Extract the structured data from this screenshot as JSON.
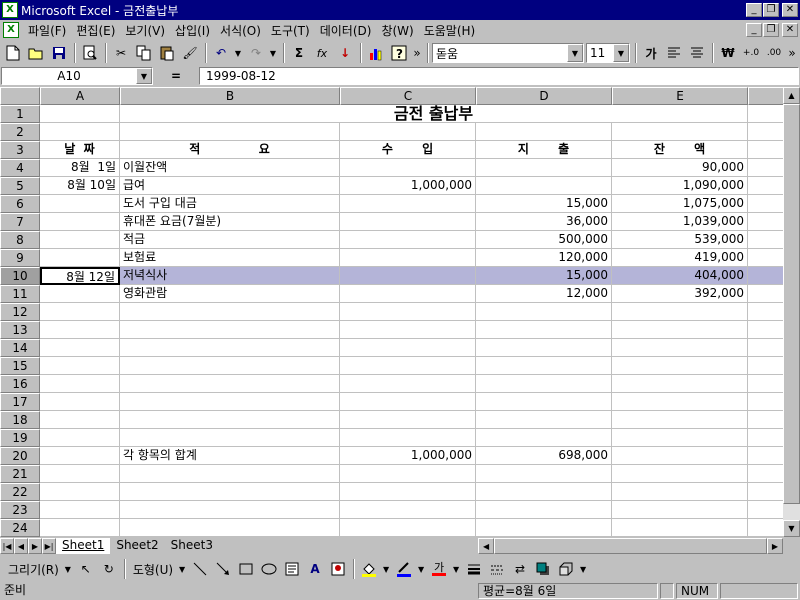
{
  "window": {
    "title": "Microsoft Excel - 금전출납부",
    "app_icon": "excel-icon"
  },
  "menu": {
    "items": [
      "파일(F)",
      "편집(E)",
      "보기(V)",
      "삽입(I)",
      "서식(O)",
      "도구(T)",
      "데이터(D)",
      "창(W)",
      "도움말(H)"
    ]
  },
  "toolbar": {
    "font_name": "돋움",
    "font_size": "11",
    "sum_label": "Σ",
    "fx_label": "fx",
    "sort_label": "↓",
    "bold_label": "가",
    "more_label": "»",
    "currency_label": "₩",
    "inc_decimal_label": "+.0",
    "dec_decimal_label": ".00"
  },
  "formula_bar": {
    "name_box": "A10",
    "eq": "=",
    "value": "1999-08-12"
  },
  "columns": [
    {
      "label": "A"
    },
    {
      "label": "B"
    },
    {
      "label": "C"
    },
    {
      "label": "D"
    },
    {
      "label": "E"
    },
    {
      "label": ""
    }
  ],
  "rows": [
    {
      "n": "1",
      "cells": [
        "",
        "금전 출납부",
        "",
        "",
        "",
        ""
      ]
    },
    {
      "n": "2",
      "cells": [
        "",
        "",
        "",
        "",
        "",
        ""
      ]
    },
    {
      "n": "3",
      "cells": [
        "날  짜",
        "적              요",
        "수       입",
        "지       출",
        "잔       액",
        ""
      ]
    },
    {
      "n": "4",
      "cells": [
        "8월  1일",
        "이월잔액",
        "",
        "",
        "90,000",
        ""
      ]
    },
    {
      "n": "5",
      "cells": [
        "8월 10일",
        "급여",
        "1,000,000",
        "",
        "1,090,000",
        ""
      ]
    },
    {
      "n": "6",
      "cells": [
        "",
        "도서 구입 대금",
        "",
        "15,000",
        "1,075,000",
        ""
      ]
    },
    {
      "n": "7",
      "cells": [
        "",
        "휴대폰 요금(7월분)",
        "",
        "36,000",
        "1,039,000",
        ""
      ]
    },
    {
      "n": "8",
      "cells": [
        "",
        "적금",
        "",
        "500,000",
        "539,000",
        ""
      ]
    },
    {
      "n": "9",
      "cells": [
        "",
        "보험료",
        "",
        "120,000",
        "419,000",
        ""
      ]
    },
    {
      "n": "10",
      "cells": [
        "8월 12일",
        "저녁식사",
        "",
        "15,000",
        "404,000",
        ""
      ]
    },
    {
      "n": "11",
      "cells": [
        "",
        "영화관람",
        "",
        "12,000",
        "392,000",
        ""
      ]
    },
    {
      "n": "12",
      "cells": [
        "",
        "",
        "",
        "",
        "",
        ""
      ]
    },
    {
      "n": "13",
      "cells": [
        "",
        "",
        "",
        "",
        "",
        ""
      ]
    },
    {
      "n": "14",
      "cells": [
        "",
        "",
        "",
        "",
        "",
        ""
      ]
    },
    {
      "n": "15",
      "cells": [
        "",
        "",
        "",
        "",
        "",
        ""
      ]
    },
    {
      "n": "16",
      "cells": [
        "",
        "",
        "",
        "",
        "",
        ""
      ]
    },
    {
      "n": "17",
      "cells": [
        "",
        "",
        "",
        "",
        "",
        ""
      ]
    },
    {
      "n": "18",
      "cells": [
        "",
        "",
        "",
        "",
        "",
        ""
      ]
    },
    {
      "n": "19",
      "cells": [
        "",
        "",
        "",
        "",
        "",
        ""
      ]
    },
    {
      "n": "20",
      "cells": [
        "",
        "각 항목의 합계",
        "1,000,000",
        "698,000",
        "",
        ""
      ]
    },
    {
      "n": "21",
      "cells": [
        "",
        "",
        "",
        "",
        "",
        ""
      ]
    },
    {
      "n": "22",
      "cells": [
        "",
        "",
        "",
        "",
        "",
        ""
      ]
    },
    {
      "n": "23",
      "cells": [
        "",
        "",
        "",
        "",
        "",
        ""
      ]
    },
    {
      "n": "24",
      "cells": [
        "",
        "",
        "",
        "",
        "",
        ""
      ]
    }
  ],
  "selected_row": "10",
  "sheet_tabs": [
    "Sheet1",
    "Sheet2",
    "Sheet3"
  ],
  "active_tab": "Sheet1",
  "drawing_toolbar": {
    "draw_label": "그리기(R)",
    "autoshape_label": "도형(U)",
    "font_color_label": "가"
  },
  "status": {
    "ready": "준비",
    "average": "평균=8월 6일",
    "num": "NUM"
  },
  "colors": {
    "title_bar": "#000080",
    "selection": "#b4b4d8",
    "chrome": "#c0c0c0"
  }
}
